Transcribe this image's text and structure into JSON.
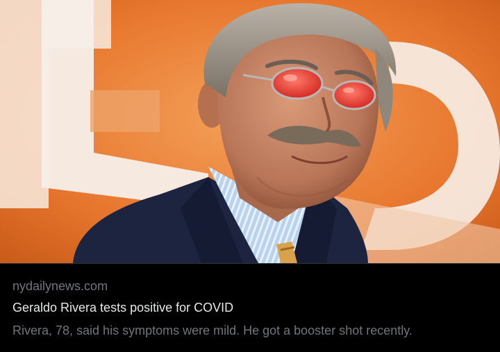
{
  "link_card": {
    "domain": "nydailynews.com",
    "title": "Geraldo Rivera tests positive for COVID",
    "description": "Rivera, 78, said his symptoms were mild. He got a booster shot recently."
  },
  "colors": {
    "background": "#000000",
    "title_text": "#e7e9ea",
    "secondary_text": "#71767b",
    "backdrop_orange": "#e8772e"
  }
}
